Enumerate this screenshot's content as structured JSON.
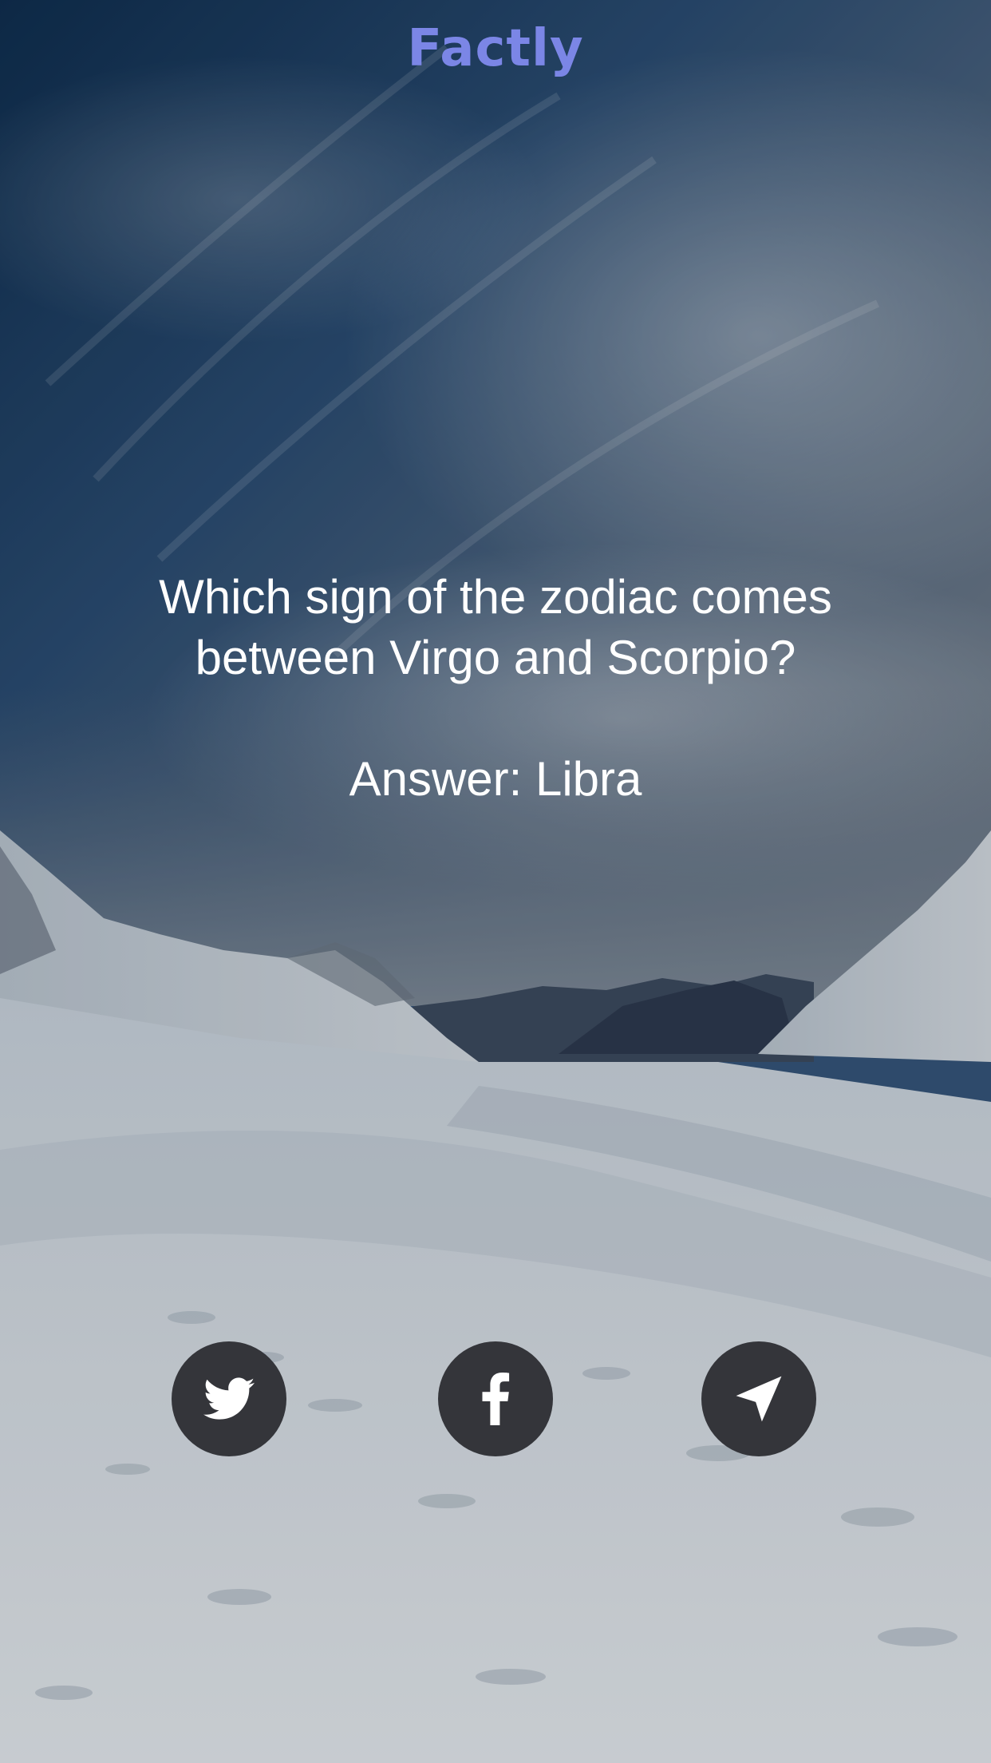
{
  "app": {
    "title": "Factly",
    "title_color": "#7b86e6"
  },
  "fact": {
    "question": "Which sign of the zodiac comes between Virgo and Scorpio?",
    "answer": "Answer: Libra"
  },
  "share_buttons": [
    {
      "icon": "twitter-icon"
    },
    {
      "icon": "facebook-icon"
    },
    {
      "icon": "send-arrow-icon"
    }
  ],
  "colors": {
    "button_bg": "#34353a",
    "icon": "#ffffff",
    "text": "#ffffff"
  }
}
